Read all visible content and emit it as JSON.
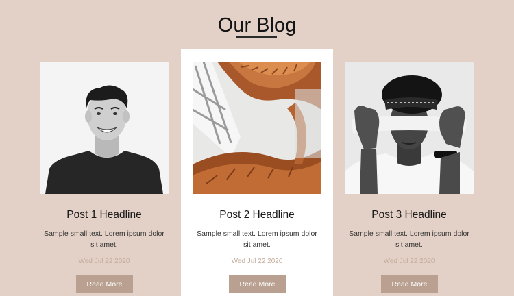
{
  "header": {
    "title": "Our Blog"
  },
  "posts": [
    {
      "headline": "Post 1 Headline",
      "excerpt": "Sample small text. Lorem ipsum dolor sit amet.",
      "date": "Wed Jul 22 2020",
      "button_label": "Read More",
      "image": "portrait-smiling-man"
    },
    {
      "headline": "Post 2 Headline",
      "excerpt": "Sample small text. Lorem ipsum dolor sit amet.",
      "date": "Wed Jul 22 2020",
      "button_label": "Read More",
      "image": "spiral-staircase"
    },
    {
      "headline": "Post 3 Headline",
      "excerpt": "Sample small text. Lorem ipsum dolor sit amet.",
      "date": "Wed Jul 22 2020",
      "button_label": "Read More",
      "image": "blindfolded-man"
    }
  ],
  "colors": {
    "background": "#e3d0c6",
    "card_highlight": "#ffffff",
    "button": "#b9a090",
    "date_text": "#c3ac9c"
  }
}
